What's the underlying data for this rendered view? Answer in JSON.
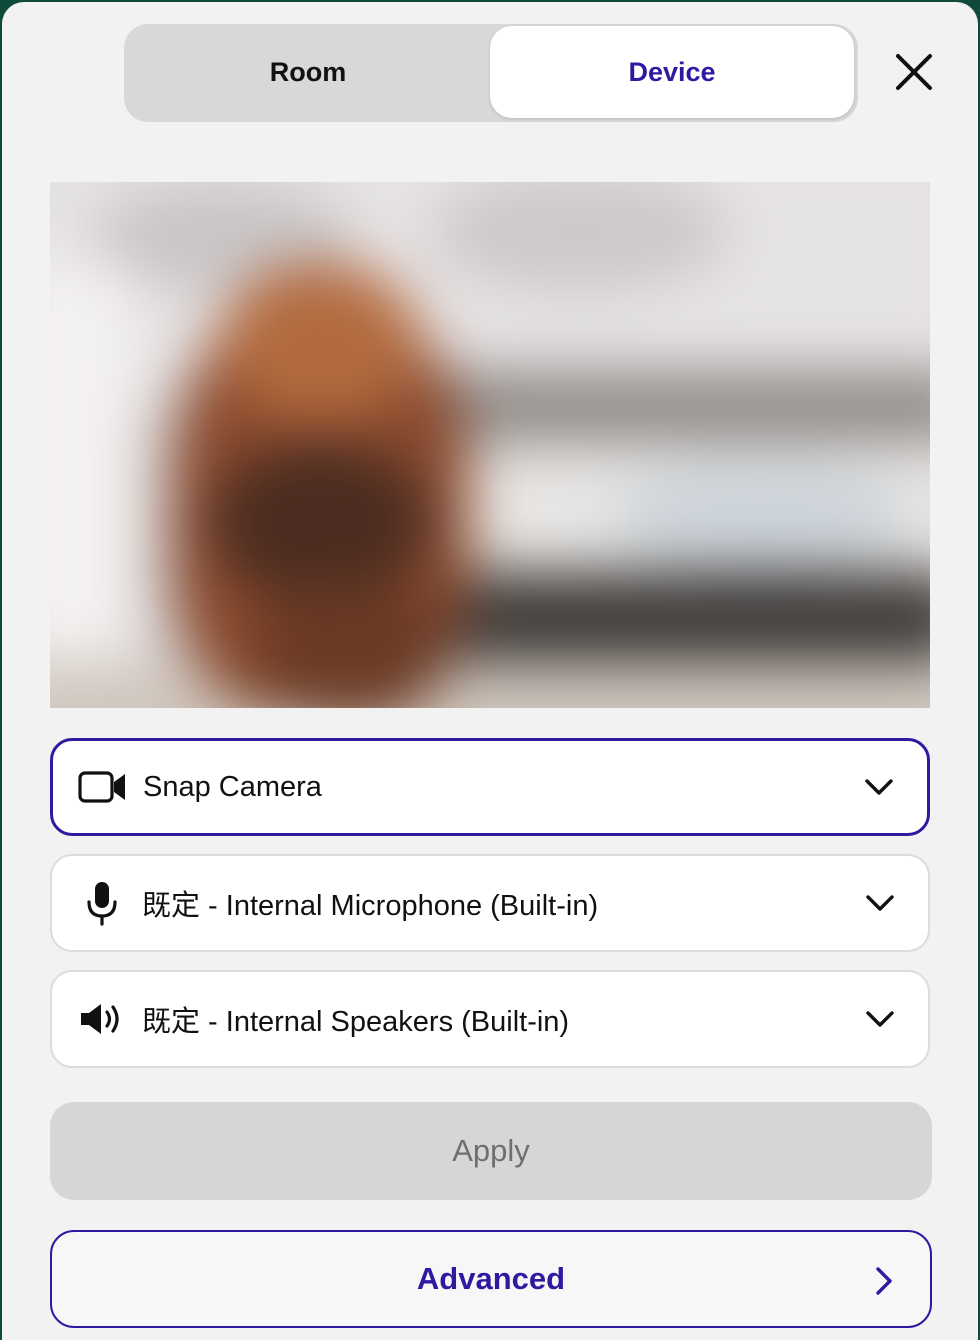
{
  "tabs": {
    "room_label": "Room",
    "device_label": "Device",
    "selected": "Device"
  },
  "colors": {
    "accent": "#2d1aa0",
    "panel_bg": "#f2f2f2",
    "segment_bg": "#d8d8d8",
    "apply_bg": "#d6d6d6"
  },
  "devices": {
    "camera": {
      "icon": "video-camera-icon",
      "value": "Snap Camera"
    },
    "microphone": {
      "icon": "microphone-icon",
      "value": "既定 - Internal Microphone (Built-in)"
    },
    "speaker": {
      "icon": "speaker-icon",
      "value": "既定 - Internal Speakers (Built-in)"
    }
  },
  "actions": {
    "apply_label": "Apply",
    "advanced_label": "Advanced"
  }
}
